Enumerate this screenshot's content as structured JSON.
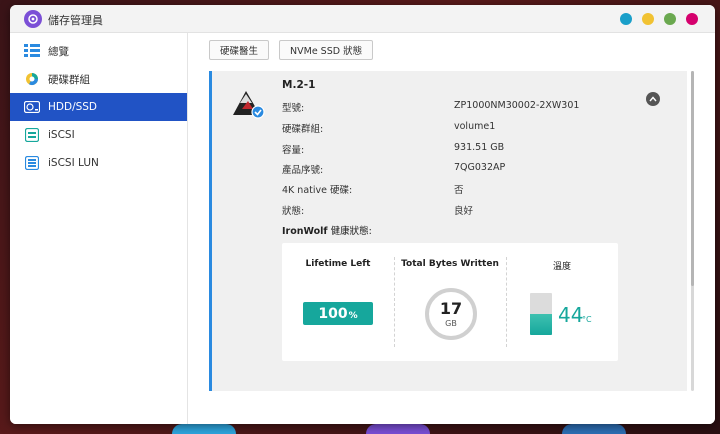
{
  "app": {
    "title": "儲存管理員",
    "window_dots": [
      "#1a9fc9",
      "#f1c232",
      "#6aa84f",
      "#d5006d"
    ]
  },
  "sidebar": {
    "items": [
      {
        "label": "總覽",
        "icon": "overview-icon",
        "active": false
      },
      {
        "label": "硬碟群組",
        "icon": "disk-group-icon",
        "active": false
      },
      {
        "label": "HDD/SSD",
        "icon": "hdd-ssd-icon",
        "active": true
      },
      {
        "label": "iSCSI",
        "icon": "iscsi-icon",
        "active": false
      },
      {
        "label": "iSCSI LUN",
        "icon": "iscsi-lun-icon",
        "active": false
      }
    ]
  },
  "toolbar": {
    "disk_doctor_label": "硬碟醫生",
    "nvme_status_label": "NVMe SSD 狀態"
  },
  "disk": {
    "name": "M.2-1",
    "rows": [
      {
        "label": "型號:",
        "value": "ZP1000NM30002-2XW301"
      },
      {
        "label": "硬碟群組:",
        "value": "volume1"
      },
      {
        "label": "容量:",
        "value": "931.51 GB"
      },
      {
        "label": "產品序號:",
        "value": "7QG032AP"
      },
      {
        "label": "4K native 硬碟:",
        "value": "否"
      },
      {
        "label": "狀態:",
        "value": "良好"
      }
    ],
    "health_brand": "IronWolf",
    "health_suffix": " 健康狀態:"
  },
  "health": {
    "lifetime_label": "Lifetime Left",
    "lifetime_value": "100",
    "lifetime_unit": "%",
    "tbw_label": "Total Bytes Written",
    "tbw_value": "17",
    "tbw_unit": "GB",
    "temp_label": "溫度",
    "temp_value": "44",
    "temp_unit": "°C",
    "accent_color": "#16a79c"
  }
}
